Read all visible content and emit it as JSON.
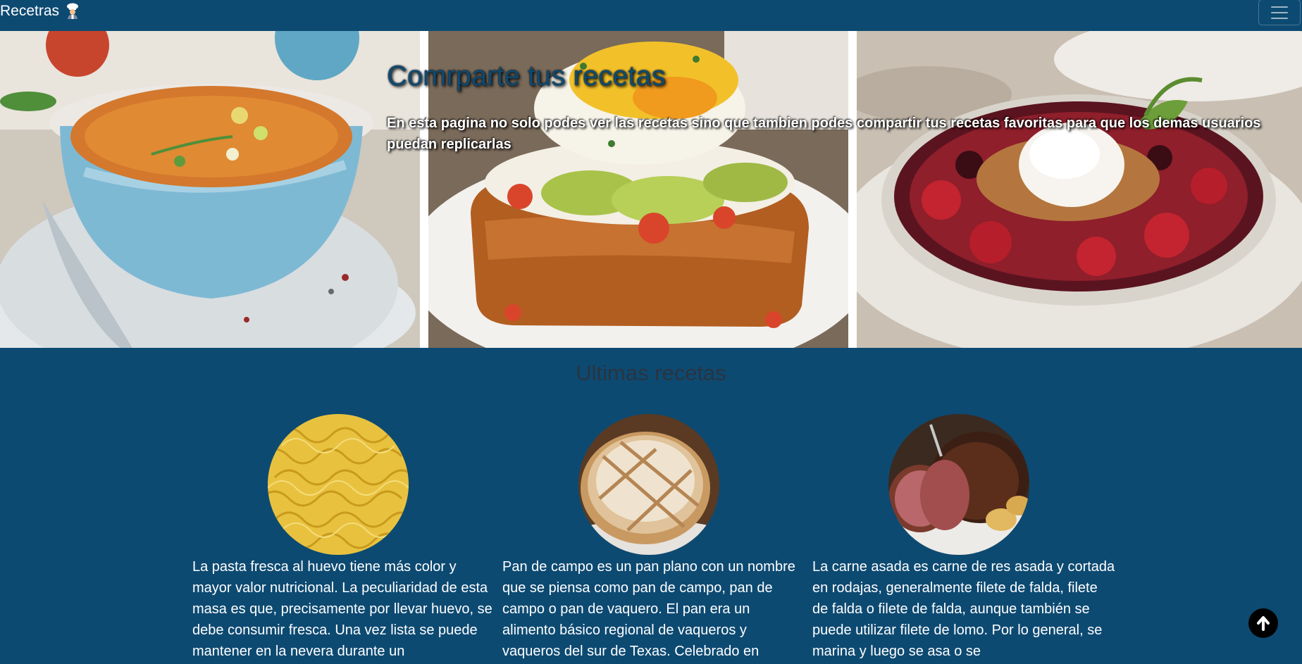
{
  "navbar": {
    "brand": "Recetras",
    "brand_icon": "chef-icon",
    "menu_icon": "hamburger-menu-icon"
  },
  "hero": {
    "title": "Comrparte tus recetas",
    "subtitle": "En esta pagina no solo podes ver las recetas sino que tambien podes compartir tus recetas favoritas para que los demas usuarios puedan replicarlas",
    "images": [
      "soup-bowl-image",
      "avocado-egg-toast-image",
      "berry-ice-cream-bowl-image"
    ]
  },
  "latest": {
    "title": "Ultimas recetas",
    "recipes": [
      {
        "image": "pasta-image",
        "text": "La pasta fresca al huevo tiene más color y mayor valor nutricional. La peculiaridad de esta masa es que, precisamente por llevar huevo, se debe consumir fresca. Una vez lista se puede mantener en la nevera durante un"
      },
      {
        "image": "bread-image",
        "text": "Pan de campo es un pan plano con un nombre que se piensa como pan de campo, pan de campo o pan de vaquero. El pan era un alimento básico regional de vaqueros y vaqueros del sur de Texas. Celebrado en"
      },
      {
        "image": "roast-beef-image",
        "text": "La carne asada es carne de res asada y cortada en rodajas, generalmente filete de falda, filete de falda o filete de falda, aunque también se puede utilizar filete de lomo. Por lo general, se marina y luego se asa o se"
      }
    ]
  },
  "back_to_top_icon": "arrow-up-icon",
  "colors": {
    "navbar": "#0d4a72",
    "background": "#0d4a72",
    "section_title": "#2a3440"
  }
}
